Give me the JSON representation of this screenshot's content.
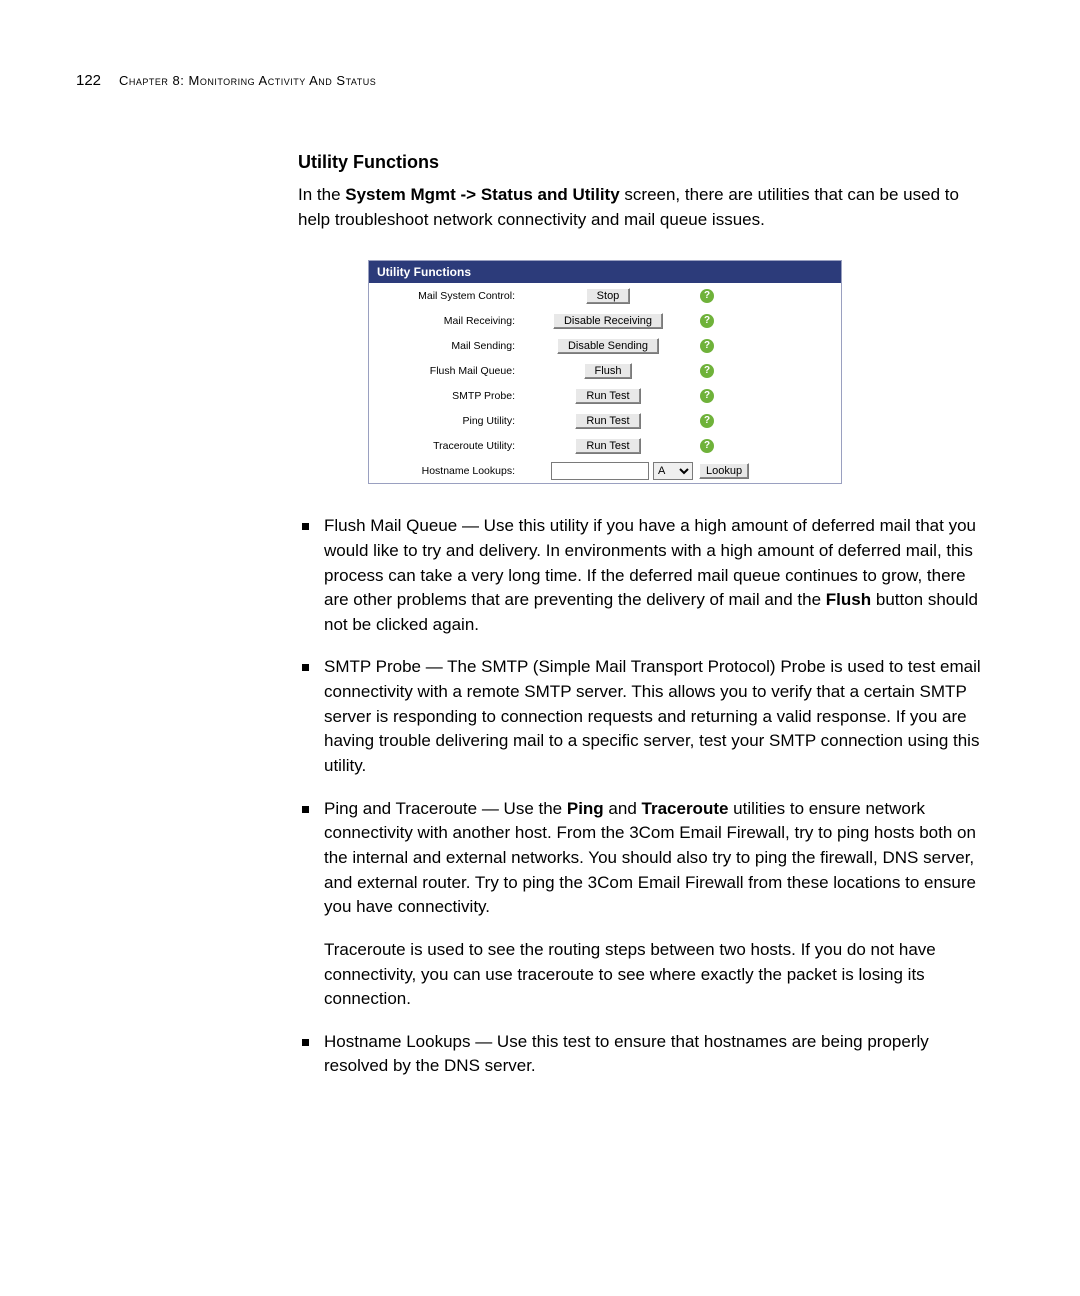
{
  "header": {
    "page_number": "122",
    "chapter_label": "Chapter 8: Monitoring Activity And Status"
  },
  "section_title": "Utility Functions",
  "intro": {
    "pre": "In the ",
    "bold": "System Mgmt -> Status and Utility",
    "post": " screen, there are utilities that can be used to help troubleshoot network connectivity and mail queue issues."
  },
  "panel": {
    "title": "Utility Functions",
    "rows": {
      "mail_system_control": {
        "label": "Mail System Control:",
        "button": "Stop"
      },
      "mail_receiving": {
        "label": "Mail Receiving:",
        "button": "Disable Receiving"
      },
      "mail_sending": {
        "label": "Mail Sending:",
        "button": "Disable Sending"
      },
      "flush_mail_queue": {
        "label": "Flush Mail Queue:",
        "button": "Flush"
      },
      "smtp_probe": {
        "label": "SMTP Probe:",
        "button": "Run Test"
      },
      "ping_utility": {
        "label": "Ping Utility:",
        "button": "Run Test"
      },
      "traceroute_utility": {
        "label": "Traceroute Utility:",
        "button": "Run Test"
      },
      "hostname_lookups": {
        "label": "Hostname Lookups:",
        "select": "A",
        "button": "Lookup"
      }
    },
    "help_glyph": "?"
  },
  "bullets": {
    "flush": {
      "pre": "Flush Mail Queue — Use this utility if you have a high amount of deferred mail that you would like to try and delivery. In environments with a high amount of deferred mail, this process can take a very long time. If the deferred mail queue continues to grow, there are other problems that are preventing the delivery of mail and the ",
      "bold": "Flush",
      "post": " button should not be clicked again."
    },
    "smtp": "SMTP Probe — The SMTP (Simple Mail Transport Protocol) Probe is used to test email connectivity with a remote SMTP server. This allows you to verify that a certain SMTP server is responding to connection requests and returning a valid response. If you are having trouble delivering mail to a specific server, test your SMTP connection using this utility.",
    "ping": {
      "pre": "Ping and Traceroute — Use the ",
      "b1": "Ping",
      "mid": " and ",
      "b2": "Traceroute",
      "post": " utilities to ensure network connectivity with another host. From the 3Com Email Firewall, try to ping hosts both on the internal and external networks. You should also try to ping the firewall, DNS server, and external router. Try to ping the 3Com Email Firewall from these locations to ensure you have connectivity."
    },
    "traceroute_para": "Traceroute is used to see the routing steps between two hosts. If you do not have connectivity, you can use traceroute to see where exactly the packet is losing its connection.",
    "hostname": "Hostname Lookups — Use this test to ensure that hostnames are being properly resolved by the DNS server."
  }
}
